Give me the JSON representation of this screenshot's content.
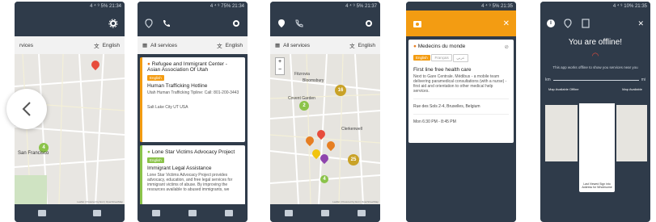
{
  "phone1": {
    "status": "4 ⁴ ⁹ 5% 21:34",
    "filter_left": "rvices",
    "filter_right": "English",
    "map_label": "San Francisco",
    "attribution": "Leaflet | Powered by Esri | OpenStreetMap"
  },
  "phone2": {
    "status": "4 ⁴ ⁹ 75% 21:34",
    "filter_left": "All services",
    "filter_right": "English",
    "card1": {
      "title": "Refugee and Immigrant Center - Asian Association Of Utah",
      "badge": "English",
      "service": "Human Trafficking Hotline",
      "desc": "Utah Human Trafficking Tipline: Call: 801-200-3443",
      "location": "Salt Lake City UT USA"
    },
    "card2": {
      "title": "Lone Star Victims Advocacy Project",
      "badge": "English",
      "service": "Immigrant Legal Assistance",
      "desc": "Lone Star Victims Advocacy Project provides advocacy, education, and free legal services for immigrant victims of abuse. By improving the resources available to abused immigrants, we"
    }
  },
  "phone3": {
    "status": "4 ⁴ ⁹ 5% 21:37",
    "filter_left": "All services",
    "filter_right": "English",
    "clusters": [
      "16",
      "2",
      "25",
      "4"
    ],
    "labels": [
      "Fitzrovia",
      "Bloomsbury",
      "Covent Garden",
      "Clerkenwell"
    ],
    "attribution": "Leaflet | Powered by Esri | OpenStreetMap"
  },
  "phone4": {
    "status": "4 ⁴ ⁹ 5% 21:35",
    "org": "Medecins du monde",
    "badges": [
      "English",
      "Français",
      "عربي"
    ],
    "service": "First line free health care",
    "desc": "Next to Gare Centrale. Médibus - a mobile team delivering paramedical consultations (with a nurse) - first aid and orientation to other medical help services.",
    "address": "Rue des Sols 2-4, Bruxelles, Belgium",
    "hours": "Mon 6:30 PM - 8:45 PM"
  },
  "phone5": {
    "status": "4 ⁴ ⁹ 10% 21:35",
    "heading": "You are offline!",
    "text": "This app works offline to show you services near you",
    "km_left": "km",
    "km_right": "mi",
    "map_left": "Map Available Offline",
    "map_right": "Map Available",
    "bottom": "Last Viewed Sign into Address for Wholesome"
  },
  "colors": {
    "header": "#2f3b4a",
    "accent": "#f39c12",
    "green": "#8bc34a"
  }
}
